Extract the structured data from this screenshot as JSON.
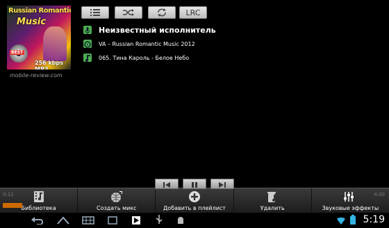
{
  "album": {
    "title_line1": "Russian Romantic",
    "title_line2": "Music",
    "badge": "BEST",
    "bitrate": "256 kbps MP3"
  },
  "watermark": "mobile-review.com",
  "toolbar": {
    "lrc_label": "LRC"
  },
  "track": {
    "artist": "Неизвестный исполнитель",
    "album": "VA – Russian Romantic Music 2012",
    "title": "065. Тина Кароль - Белое Небо"
  },
  "playback": {
    "elapsed": "0:12",
    "duration": "4:00",
    "progress": 0.05
  },
  "actions": [
    {
      "label": "Библиотека"
    },
    {
      "label": "Создать микс"
    },
    {
      "label": "Добавить в плейлист"
    },
    {
      "label": "Удалить"
    },
    {
      "label": "Звуковые эффекты"
    }
  ],
  "status": {
    "time": "5:19"
  },
  "colors": {
    "accent_green": "#4caf50",
    "progress_orange": "#cc6a00",
    "status_blue": "#33b5e5"
  }
}
